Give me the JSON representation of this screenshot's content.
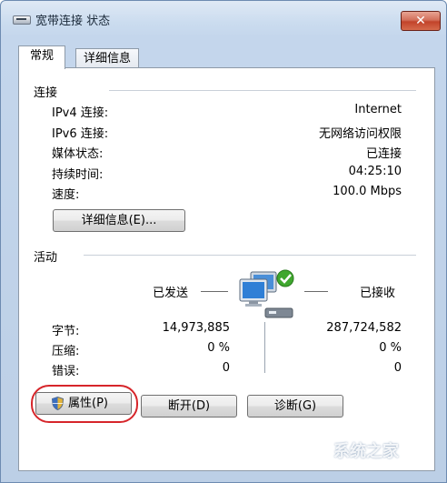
{
  "window": {
    "title": "宽带连接 状态",
    "close_label": "✕"
  },
  "tabs": [
    {
      "label": "常规",
      "active": true
    },
    {
      "label": "详细信息",
      "active": false
    }
  ],
  "connection": {
    "heading": "连接",
    "rows": [
      {
        "label": "IPv4 连接:",
        "value": "Internet"
      },
      {
        "label": "IPv6 连接:",
        "value": "无网络访问权限"
      },
      {
        "label": "媒体状态:",
        "value": "已连接"
      },
      {
        "label": "持续时间:",
        "value": "04:25:10"
      },
      {
        "label": "速度:",
        "value": "100.0 Mbps"
      }
    ],
    "details_button": "详细信息(E)..."
  },
  "activity": {
    "heading": "活动",
    "sent_label": "已发送",
    "received_label": "已接收",
    "icon": "network-computers-icon",
    "rows": [
      {
        "label": "字节:",
        "sent": "14,973,885",
        "received": "287,724,582"
      },
      {
        "label": "压缩:",
        "sent": "0 %",
        "received": "0 %"
      },
      {
        "label": "错误:",
        "sent": "0",
        "received": "0"
      }
    ]
  },
  "buttons": {
    "properties": "属性(P)",
    "disconnect": "断开(D)",
    "diagnose": "诊断(G)"
  },
  "watermark": "系统之家",
  "colors": {
    "highlight_circle": "#d6252a",
    "close_button": "#c2432a",
    "check_badge": "#3fa72e"
  }
}
